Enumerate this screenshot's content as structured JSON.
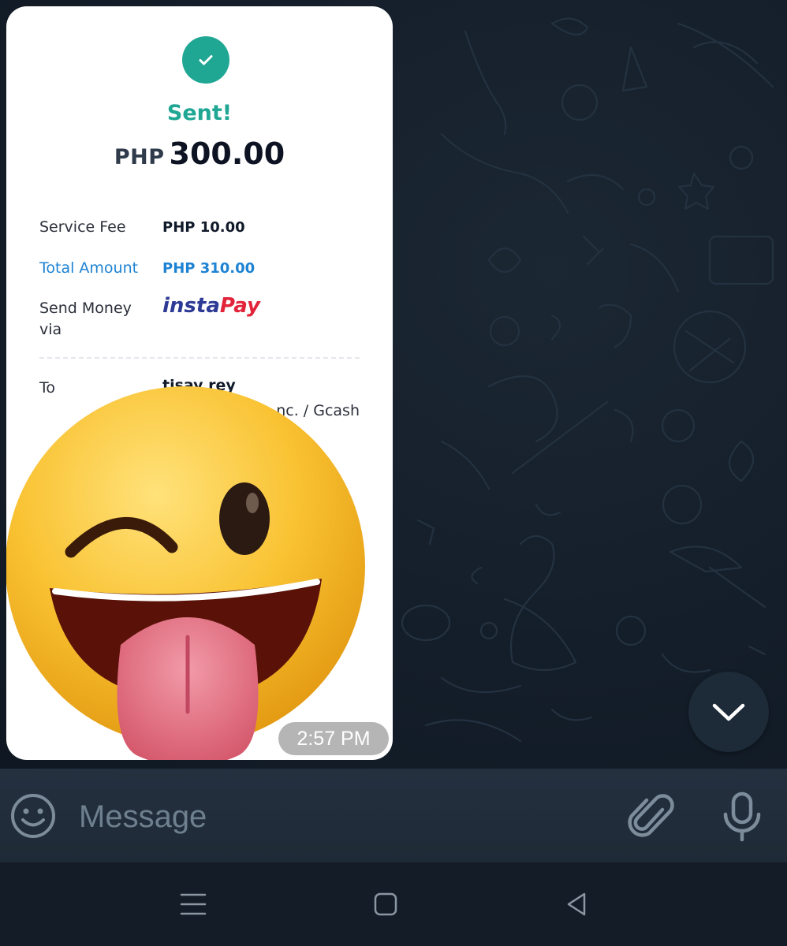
{
  "receipt": {
    "status_title": "Sent!",
    "currency": "PHP",
    "amount": "300.00",
    "service_fee_label": "Service Fee",
    "service_fee_value": "PHP 10.00",
    "total_label": "Total Amount",
    "total_value": "PHP 310.00",
    "send_via_label_line1": "Send Money",
    "send_via_label_line2": "via",
    "send_via_logo_part1": "insta",
    "send_via_logo_part2": "Pay",
    "to_label": "To",
    "recipient_name": "tisay rey",
    "recipient_bank": "nc. / Gcash"
  },
  "message": {
    "timestamp": "2:57 PM",
    "sticker_icon": "winking-tongue-face-sticker"
  },
  "composer": {
    "placeholder": "Message",
    "emoji_icon": "smile-icon",
    "attach_icon": "paperclip-icon",
    "mic_icon": "microphone-icon"
  },
  "colors": {
    "success_green": "#1fa794",
    "accent_blue": "#1f83d3",
    "instapay_blue": "#2d3b96",
    "instapay_red": "#e2243a",
    "chat_background": "#0f1923"
  }
}
